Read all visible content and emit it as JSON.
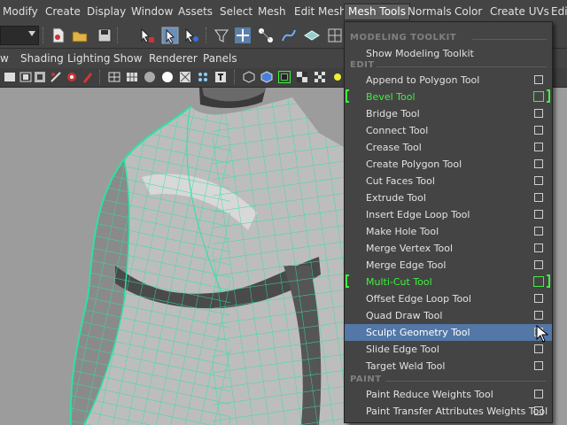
{
  "menubar": {
    "items": [
      "Modify",
      "Create",
      "Display",
      "Window",
      "Assets",
      "Select",
      "Mesh",
      "Edit Mesh",
      "Mesh Tools",
      "Normals",
      "Color",
      "Create UVs",
      "Edi"
    ],
    "open_index": 8
  },
  "panel_menu": {
    "items": [
      "w",
      "Shading",
      "Lighting",
      "Show",
      "Renderer",
      "Panels"
    ]
  },
  "dropdown": {
    "header": "MODELING TOOLKIT",
    "show_toolkit": "Show Modeling Toolkit",
    "edit_section": "EDIT",
    "edit_items": [
      {
        "label": "Append to Polygon Tool"
      },
      {
        "label": "Bevel Tool",
        "active": true
      },
      {
        "label": "Bridge Tool"
      },
      {
        "label": "Connect Tool"
      },
      {
        "label": "Crease Tool"
      },
      {
        "label": "Create Polygon Tool"
      },
      {
        "label": "Cut Faces Tool"
      },
      {
        "label": "Extrude Tool"
      },
      {
        "label": "Insert Edge Loop Tool"
      },
      {
        "label": "Make Hole Tool"
      },
      {
        "label": "Merge Vertex Tool"
      },
      {
        "label": "Merge Edge Tool"
      },
      {
        "label": "Multi-Cut Tool",
        "active": true
      },
      {
        "label": "Offset Edge Loop Tool"
      },
      {
        "label": "Quad Draw Tool"
      },
      {
        "label": "Sculpt Geometry Tool",
        "highlighted": true
      },
      {
        "label": "Slide Edge Tool"
      },
      {
        "label": "Target Weld Tool"
      }
    ],
    "paint_section": "PAINT",
    "paint_items": [
      {
        "label": "Paint Reduce Weights Tool"
      },
      {
        "label": "Paint Transfer Attributes Weights Tool"
      }
    ]
  },
  "colors": {
    "active_green": "#3ff03f",
    "highlight_blue": "#5377a6",
    "wireframe": "#2fe0a0"
  }
}
